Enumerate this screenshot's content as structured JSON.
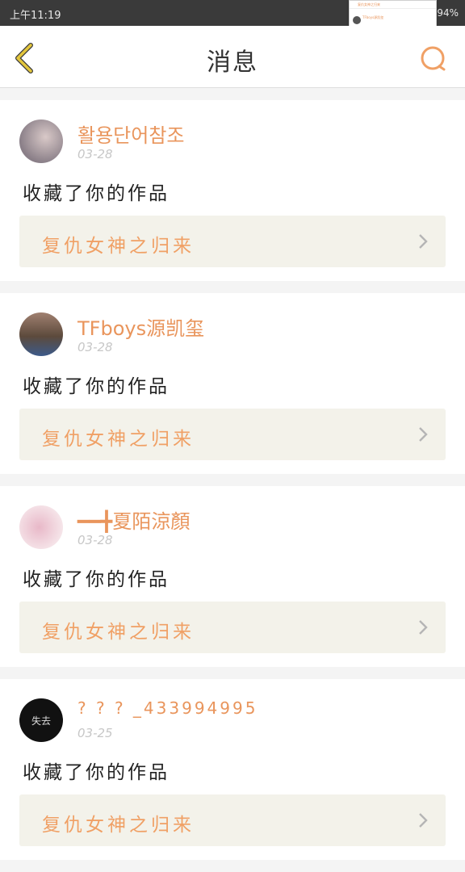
{
  "status_bar": {
    "time": "上午11:19",
    "battery": "94%"
  },
  "notification_preview": {
    "row1": "复仇女神之归来",
    "line_user": "TFboys源凯玺",
    "line_text": "收藏了你的作品",
    "row2": "复仇女神之归来"
  },
  "header": {
    "title": "消息"
  },
  "messages": [
    {
      "username": "활용단어참조",
      "date": "03-28",
      "action": "收藏了你的作品",
      "work_title": "复仇女神之归来",
      "avatar_colors": [
        "#8a7f88",
        "#d9c9c8"
      ]
    },
    {
      "username": "TFboys源凯玺",
      "date": "03-28",
      "action": "收藏了你的作品",
      "work_title": "复仇女神之归来",
      "avatar_colors": [
        "#5c4a3c",
        "#a08070"
      ]
    },
    {
      "username": "━━╋夏陌涼顏",
      "date": "03-28",
      "action": "收藏了你的作品",
      "work_title": "复仇女神之归来",
      "avatar_colors": [
        "#e8b8c8",
        "#f6e6ea"
      ]
    },
    {
      "username": "? ? ? _433994995",
      "date": "03-25",
      "action": "收藏了你的作品",
      "work_title": "复仇女神之归来",
      "avatar_colors": [
        "#111111",
        "#111111"
      ],
      "avatar_text": "失去"
    }
  ],
  "colors": {
    "accent": "#e9955c",
    "back_icon": "#e3c63c",
    "card_link_bg": "#f3f2ea"
  }
}
